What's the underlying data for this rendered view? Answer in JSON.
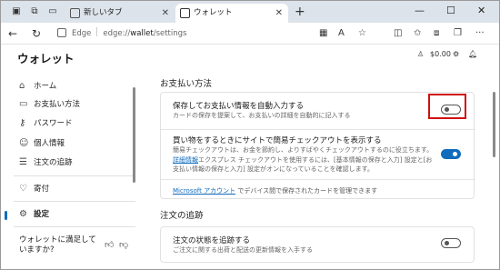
{
  "browser": {
    "tabs": [
      {
        "label": "新しいタブ",
        "active": false
      },
      {
        "label": "ウォレット",
        "active": true
      }
    ],
    "address": {
      "site_label": "Edge",
      "url_prefix": "edge://",
      "url_bold": "wallet",
      "url_suffix": "/settings"
    }
  },
  "header": {
    "title": "ウォレット",
    "balance": "$0.00"
  },
  "sidebar": {
    "items": [
      {
        "label": "ホーム",
        "icon": "home-icon"
      },
      {
        "label": "お支払い方法",
        "icon": "card-icon"
      },
      {
        "label": "パスワード",
        "icon": "key-icon"
      },
      {
        "label": "個人情報",
        "icon": "person-icon"
      },
      {
        "label": "注文の追跡",
        "icon": "list-icon"
      },
      {
        "label": "寄付",
        "icon": "heart-icon"
      },
      {
        "label": "設定",
        "icon": "gear-icon",
        "active": true
      }
    ],
    "feedback": "ウォレットに満足していますか?"
  },
  "main": {
    "payment": {
      "title": "お支払い方法",
      "autofill_title": "保存してお支払い情報を自動入力する",
      "autofill_desc": "カードの保存を提案して、お支払いの詳細を自動的に記入する",
      "autofill_on": false,
      "express_title": "買い物をするときにサイトで簡易チェックアウトを表示する",
      "express_desc_1": "簡易チェックアウトは、お金を節約し、よりすばやくチェックアウトするのに役立ちます。",
      "express_link": "詳細情報",
      "express_desc_2": "エクスプレス チェックアウトを使用するには、[基本情報の保存と入力] 設定と[お支払い情報の保存と入力] 設定がオンになっていることを確認します。",
      "express_on": true,
      "ms_link": "Microsoft アカウント",
      "ms_note": "でデバイス間で保存されたカードを管理できます"
    },
    "orders": {
      "title": "注文の追跡",
      "track_title": "注文の状態を追跡する",
      "track_desc": "ご注文に関する出荷と配送の更新情報を入手する",
      "track_on": false
    }
  }
}
